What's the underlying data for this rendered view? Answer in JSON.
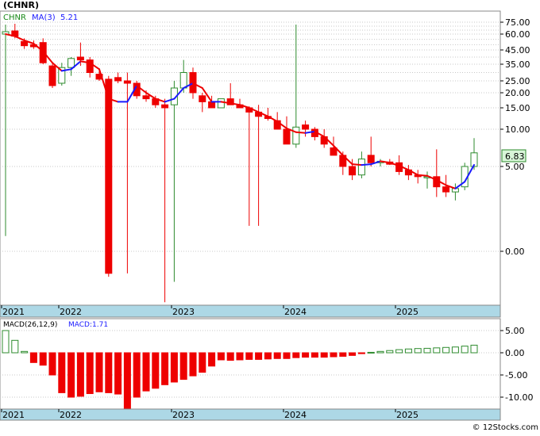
{
  "ticker": "(CHNR)",
  "credit": "© 12Stocks.com",
  "colors": {
    "up": "#2e8b2e",
    "down": "#ee0000",
    "ma_up": "#1a1aff",
    "ma_down": "#ee0000",
    "axis_band": "#add8e6",
    "grid": "#c8c8c8",
    "last_price_box": "#d8f5d8"
  },
  "chart_data": [
    {
      "type": "candlestick",
      "legend": {
        "ticker": "CHNR",
        "ma_label": "MA(3)",
        "ma_value": "5.21"
      },
      "last_price": "6.83",
      "y_tick_labels": [
        "75.00",
        "60.00",
        "45.00",
        "35.00",
        "25.00",
        "20.00",
        "15.00",
        "10.00",
        "5.00",
        "0.00"
      ],
      "x_tick_labels": [
        "2021",
        "2022",
        "2023",
        "2024",
        "2025"
      ],
      "candles": [
        {
          "o": 60,
          "h": 72,
          "l": 0.9,
          "c": 63
        },
        {
          "o": 64,
          "h": 73,
          "l": 56,
          "c": 58
        },
        {
          "o": 53,
          "h": 56,
          "l": 46,
          "c": 49
        },
        {
          "o": 50,
          "h": 54,
          "l": 46,
          "c": 48
        },
        {
          "o": 52,
          "h": 56,
          "l": 35,
          "c": 36
        },
        {
          "o": 34,
          "h": 36,
          "l": 22,
          "c": 23
        },
        {
          "o": 24,
          "h": 36,
          "l": 23,
          "c": 33
        },
        {
          "o": 33,
          "h": 40,
          "l": 28,
          "c": 39
        },
        {
          "o": 40,
          "h": 52,
          "l": 34,
          "c": 38
        },
        {
          "o": 38,
          "h": 40,
          "l": 27,
          "c": 30
        },
        {
          "o": 29,
          "h": 31,
          "l": 25,
          "c": 26
        },
        {
          "o": 26,
          "h": 28,
          "l": -1.5,
          "c": -1.3
        },
        {
          "o": 27,
          "h": 30,
          "l": 24,
          "c": 25
        },
        {
          "o": 25,
          "h": 30,
          "l": -1.3,
          "c": 24
        },
        {
          "o": 24,
          "h": 25,
          "l": 18,
          "c": 19
        },
        {
          "o": 19,
          "h": 21,
          "l": 17,
          "c": 18
        },
        {
          "o": 18,
          "h": 19,
          "l": 15,
          "c": 16
        },
        {
          "o": 16,
          "h": 18,
          "l": -3.0,
          "c": 15
        },
        {
          "o": 16,
          "h": 25,
          "l": -1.8,
          "c": 22
        },
        {
          "o": 22,
          "h": 38,
          "l": 20,
          "c": 30
        },
        {
          "o": 30,
          "h": 33,
          "l": 18,
          "c": 20
        },
        {
          "o": 19,
          "h": 20,
          "l": 14,
          "c": 17
        },
        {
          "o": 17,
          "h": 19,
          "l": 16,
          "c": 15
        },
        {
          "o": 15,
          "h": 16,
          "l": 15,
          "c": 18
        },
        {
          "o": 18,
          "h": 24,
          "l": 16,
          "c": 16
        },
        {
          "o": 16,
          "h": 18,
          "l": 15,
          "c": 15
        },
        {
          "o": 15,
          "h": 15.5,
          "l": 1.5,
          "c": 14
        },
        {
          "o": 14,
          "h": 16,
          "l": 1.5,
          "c": 13
        },
        {
          "o": 13,
          "h": 15,
          "l": 12,
          "c": 12.5
        },
        {
          "o": 12,
          "h": 14,
          "l": 11,
          "c": 10
        },
        {
          "o": 10,
          "h": 13,
          "l": 8,
          "c": 8
        },
        {
          "o": 8,
          "h": 72,
          "l": 7.5,
          "c": 10.5
        },
        {
          "o": 11,
          "h": 12,
          "l": 9,
          "c": 10
        },
        {
          "o": 10,
          "h": 10.5,
          "l": 8.5,
          "c": 9
        },
        {
          "o": 9,
          "h": 10,
          "l": 7.5,
          "c": 8
        },
        {
          "o": 7.5,
          "h": 9,
          "l": 6.5,
          "c": 6.5
        },
        {
          "o": 6.5,
          "h": 7,
          "l": 4.5,
          "c": 5
        },
        {
          "o": 5,
          "h": 6,
          "l": 4.2,
          "c": 4.5
        },
        {
          "o": 4.5,
          "h": 7,
          "l": 4.3,
          "c": 6
        },
        {
          "o": 6.5,
          "h": 9,
          "l": 5,
          "c": 5.5
        },
        {
          "o": 5.5,
          "h": 6,
          "l": 5,
          "c": 5.7
        },
        {
          "o": 5.6,
          "h": 6,
          "l": 5.2,
          "c": 5.3
        },
        {
          "o": 5.5,
          "h": 6.5,
          "l": 4.5,
          "c": 4.7
        },
        {
          "o": 4.8,
          "h": 5.2,
          "l": 4.2,
          "c": 4.5
        },
        {
          "o": 4.5,
          "h": 4.8,
          "l": 4.0,
          "c": 4.4
        },
        {
          "o": 4.4,
          "h": 4.7,
          "l": 3.7,
          "c": 4.4
        },
        {
          "o": 4.4,
          "h": 7.3,
          "l": 3.2,
          "c": 3.8
        },
        {
          "o": 3.8,
          "h": 4.5,
          "l": 3.2,
          "c": 3.5
        },
        {
          "o": 3.5,
          "h": 4,
          "l": 3.0,
          "c": 3.7
        },
        {
          "o": 3.8,
          "h": 5.5,
          "l": 3.6,
          "c": 5
        },
        {
          "o": 5,
          "h": 8.8,
          "l": 4.8,
          "c": 6.83
        }
      ],
      "ma3": [
        60,
        58,
        54,
        51,
        44,
        36,
        31,
        32,
        37,
        36,
        32,
        18,
        17,
        17,
        23,
        20,
        18,
        17,
        18,
        22,
        24,
        22,
        17,
        17,
        16.5,
        16,
        15,
        14,
        13,
        11.8,
        10.2,
        9.6,
        9.5,
        9.7,
        9.0,
        7.8,
        6.5,
        5.3,
        5.2,
        5.3,
        5.7,
        5.5,
        5.1,
        4.8,
        4.5,
        4.45,
        4.2,
        3.9,
        3.7,
        4.1,
        5.21
      ]
    },
    {
      "type": "bar",
      "legend": {
        "label": "MACD(26,12,9)",
        "value_label": "MACD:1.71"
      },
      "y_tick_labels": [
        "5.00",
        "0.00",
        "-5.00",
        "-10.00"
      ],
      "x_tick_labels": [
        "2021",
        "2022",
        "2023",
        "2024",
        "2025"
      ],
      "values": [
        5.0,
        2.8,
        0.3,
        -2.2,
        -2.8,
        -5.0,
        -9.0,
        -10.0,
        -9.8,
        -9.2,
        -8.8,
        -9.0,
        -9.3,
        -12.5,
        -10.0,
        -8.6,
        -8.0,
        -7.2,
        -6.6,
        -6.0,
        -5.2,
        -4.4,
        -3.0,
        -1.6,
        -1.7,
        -1.6,
        -1.5,
        -1.5,
        -1.4,
        -1.3,
        -1.3,
        -1.1,
        -1.0,
        -1.0,
        -1.0,
        -0.9,
        -0.8,
        -0.6,
        -0.2,
        0.1,
        0.3,
        0.5,
        0.7,
        0.85,
        0.95,
        1.0,
        1.1,
        1.2,
        1.3,
        1.5,
        1.71
      ]
    }
  ]
}
